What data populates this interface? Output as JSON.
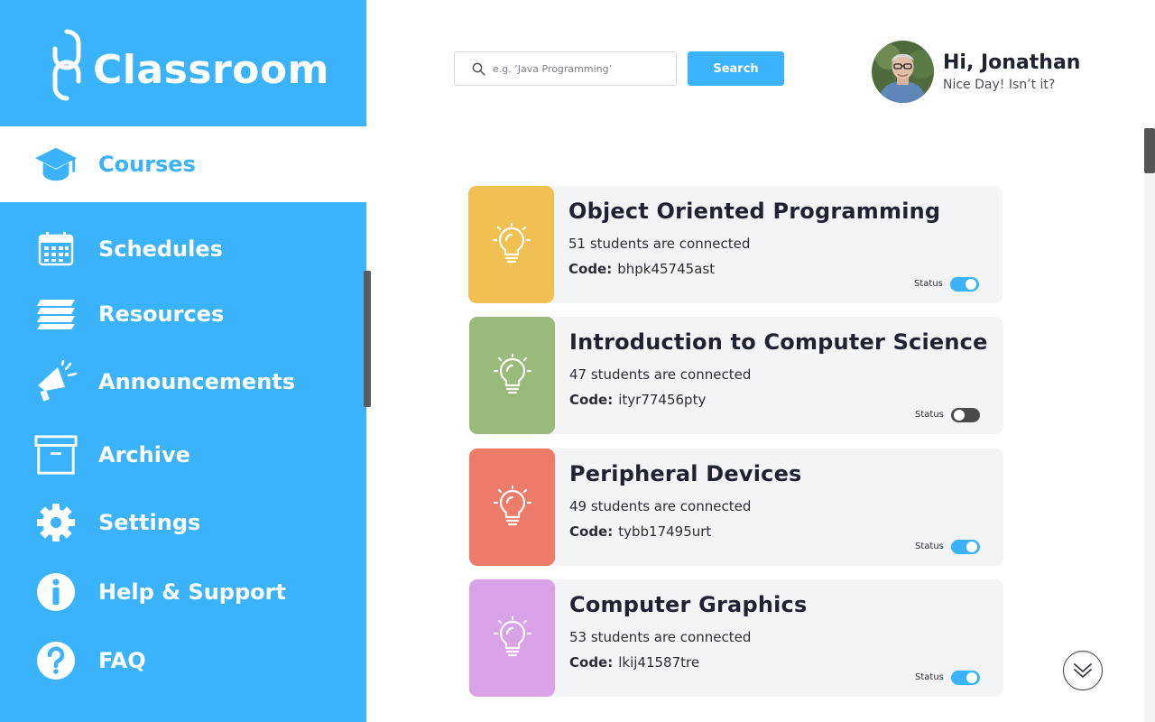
{
  "app": {
    "name": "Classroom"
  },
  "colors": {
    "accent": "#3bb3fc",
    "sidebar_bg": "#3bb3fc"
  },
  "sidebar": {
    "items": [
      {
        "label": "Courses",
        "icon": "graduation-cap-icon",
        "active": true
      },
      {
        "label": "Schedules",
        "icon": "calendar-icon",
        "active": false
      },
      {
        "label": "Resources",
        "icon": "stack-icon",
        "active": false
      },
      {
        "label": "Announcements",
        "icon": "megaphone-icon",
        "active": false
      },
      {
        "label": "Archive",
        "icon": "archive-box-icon",
        "active": false
      },
      {
        "label": "Settings",
        "icon": "gear-icon",
        "active": false
      },
      {
        "label": "Help & Support",
        "icon": "info-icon",
        "active": false
      },
      {
        "label": "FAQ",
        "icon": "question-icon",
        "active": false
      }
    ]
  },
  "search": {
    "placeholder": "e.g. ‘Java Programming’",
    "value": "",
    "button_label": "Search"
  },
  "user": {
    "greeting": "Hi, Jonathan",
    "subtitle": "Nice Day! Isn’t it?"
  },
  "courses": [
    {
      "title": "Object Oriented Programming",
      "students": "51 students are connected",
      "code_label": "Code:",
      "code": "bhpk45745ast",
      "status_label": "Status",
      "status_on": true,
      "color": "#f0c152",
      "icon": "lightbulb-icon"
    },
    {
      "title": "Introduction to Computer Science",
      "students": "47 students are connected",
      "code_label": "Code:",
      "code": "ityr77456pty",
      "status_label": "Status",
      "status_on": false,
      "color": "#9aba7b",
      "icon": "lightbulb-icon"
    },
    {
      "title": "Peripheral Devices",
      "students": "49 students are connected",
      "code_label": "Code:",
      "code": "tybb17495urt",
      "status_label": "Status",
      "status_on": true,
      "color": "#ec7b69",
      "icon": "lightbulb-icon"
    },
    {
      "title": "Computer Graphics",
      "students": "53 students are connected",
      "code_label": "Code:",
      "code": "lkij41587tre",
      "status_label": "Status",
      "status_on": true,
      "color": "#d9a2e6",
      "icon": "lightbulb-icon"
    }
  ]
}
